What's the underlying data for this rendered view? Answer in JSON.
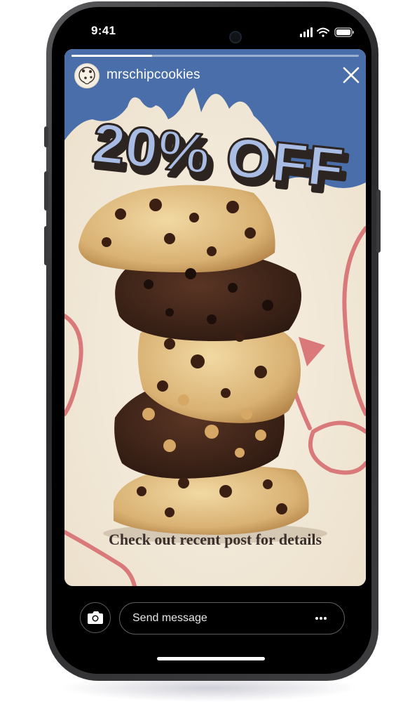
{
  "status_bar": {
    "time": "9:41",
    "icons": [
      "signal-icon",
      "wifi-icon",
      "battery-icon"
    ]
  },
  "story": {
    "progress": 0.28,
    "account": {
      "username": "mrschipcookies",
      "avatar_icon": "cookie-mascot-icon"
    },
    "close_icon": "close-icon",
    "headline": "20% OFF",
    "caption": "Check out recent post for details",
    "colors": {
      "blue": "#4a6eaa",
      "headline_fill": "#a9bde4",
      "headline_shadow": "#2c2420",
      "cream": "#f3eadb",
      "pink_lines": "#d9797a"
    }
  },
  "reply_bar": {
    "camera_icon": "camera-icon",
    "message_placeholder": "Send message",
    "more_icon": "more-dots-icon"
  }
}
